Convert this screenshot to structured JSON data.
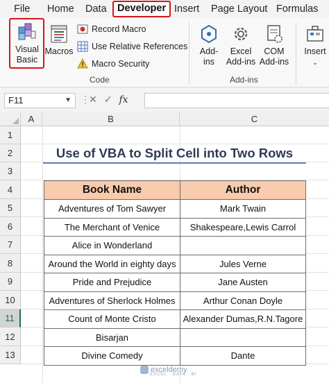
{
  "ribbon": {
    "tabs": [
      "File",
      "Home",
      "Data",
      "Developer",
      "Insert",
      "Page Layout",
      "Formulas"
    ],
    "code_group": {
      "visual_basic": "Visual\nBasic",
      "visual_basic_l1": "Visual",
      "visual_basic_l2": "Basic",
      "macros": "Macros",
      "record_macro": "Record Macro",
      "relative_refs": "Use Relative References",
      "macro_security": "Macro Security",
      "label": "Code"
    },
    "addins_group": {
      "addins_l1": "Add-",
      "addins_l2": "ins",
      "excel_addins_l1": "Excel",
      "excel_addins_l2": "Add-ins",
      "com_addins_l1": "COM",
      "com_addins_l2": "Add-ins",
      "label": "Add-ins"
    },
    "insert_button": "Insert"
  },
  "formula_bar": {
    "name_box": "F11",
    "fx_label": "fx",
    "formula": ""
  },
  "sheet": {
    "columns": [
      "A",
      "B",
      "C"
    ],
    "rows": [
      "1",
      "2",
      "3",
      "4",
      "5",
      "6",
      "7",
      "8",
      "9",
      "10",
      "11",
      "12",
      "13"
    ],
    "selected_row": "11",
    "title": "Use of VBA to Split Cell into Two Rows",
    "table": {
      "headers": [
        "Book Name",
        "Author"
      ],
      "rows": [
        [
          "Adventures of Tom Sawyer",
          "Mark Twain"
        ],
        [
          "The Merchant of Venice",
          "Shakespeare,Lewis Carrol"
        ],
        [
          "Alice in Wonderland",
          ""
        ],
        [
          "Around the World in eighty days",
          "Jules Verne"
        ],
        [
          "Pride and Prejudice",
          "Jane Austen"
        ],
        [
          "Adventures of Sherlock Holmes",
          "Arthur Conan Doyle"
        ],
        [
          "Count of Monte Cristo",
          "Alexander Dumas,R.N.Tagore"
        ],
        [
          "Bisarjan",
          ""
        ],
        [
          "Divine Comedy",
          "Dante"
        ]
      ]
    }
  },
  "watermark": {
    "name": "exceldemy",
    "tagline": "EXCEL · DATA · BI"
  },
  "colors": {
    "accent_red": "#d8121f",
    "header_fill": "#f8cbad",
    "title_underline": "#5b86c1",
    "excel_green": "#1e7145"
  }
}
